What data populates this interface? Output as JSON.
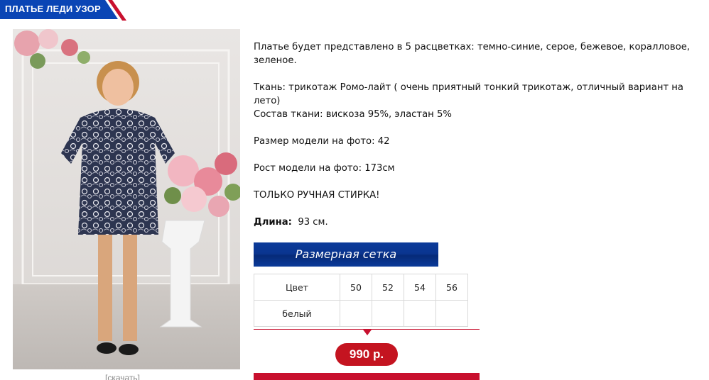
{
  "product": {
    "title": "ПЛАТЬЕ ЛЕДИ УЗОР",
    "download_link": "[скачать]"
  },
  "description": {
    "colors_line1": "Платье будет представлено в 5 расцветках: темно-синие, серое, бежевое, коралловое,",
    "colors_line2": "зеленое.",
    "fabric": "Ткань: трикотаж Ромо-лайт ( очень приятный тонкий трикотаж, отличный вариант на лето)",
    "composition": "Состав ткани: вискоза 95%, эластан 5%",
    "model_size": "Размер модели на фото: 42",
    "model_height": "Рост модели на фото: 173см",
    "wash": "ТОЛЬКО РУЧНАЯ СТИРКА!",
    "length_label": "Длина:",
    "length_value": "93 см."
  },
  "size_chart": {
    "button_label": "Размерная сетка",
    "header": [
      "Цвет",
      "50",
      "52",
      "54",
      "56"
    ],
    "rows": [
      [
        "белый",
        "",
        "",
        "",
        ""
      ]
    ]
  },
  "price": "990 р.",
  "colors": {
    "brand_blue": "#0a3a9a",
    "accent_red": "#c8102e",
    "price_red": "#c41420"
  }
}
